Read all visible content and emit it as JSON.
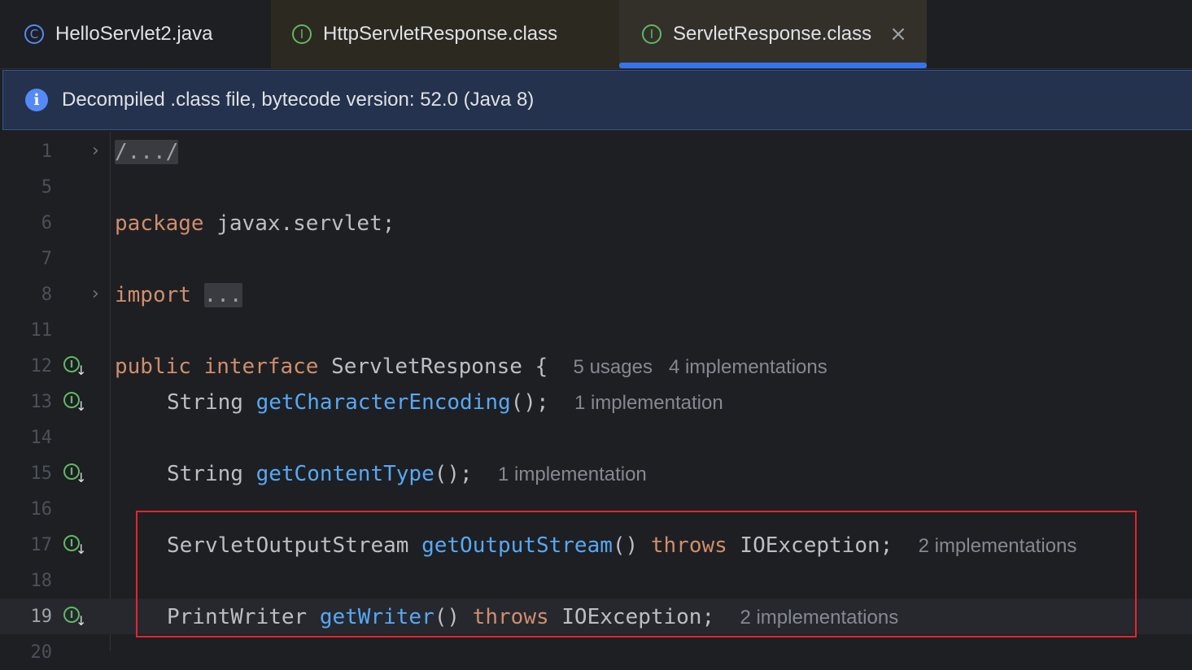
{
  "tabs": [
    {
      "label": "HelloServlet2.java",
      "icon": "class-icon",
      "icon_glyph": "C"
    },
    {
      "label": "HttpServletResponse.class",
      "icon": "interface-icon",
      "icon_glyph": "I"
    },
    {
      "label": "ServletResponse.class",
      "icon": "interface-icon",
      "icon_glyph": "I",
      "active": true,
      "close_glyph": "×"
    }
  ],
  "banner": {
    "message": "Decompiled .class file, bytecode version: 52.0 (Java 8)",
    "icon_glyph": "i"
  },
  "editor": {
    "lines": [
      {
        "n": "1",
        "folded": "/.../"
      },
      {
        "n": "5"
      },
      {
        "n": "6",
        "kw": "package",
        "rest": " javax.servlet;"
      },
      {
        "n": "7"
      },
      {
        "n": "8",
        "kw": "import",
        "folded": "..."
      },
      {
        "n": "11"
      },
      {
        "n": "12",
        "kw1": "public",
        "kw2": "interface",
        "rest": " ServletResponse {",
        "hint": "5 usages   4 implementations"
      },
      {
        "n": "13",
        "type": "String ",
        "fn": "getCharacterEncoding",
        "rest": "();",
        "hint": "1 implementation"
      },
      {
        "n": "14"
      },
      {
        "n": "15",
        "type": "String ",
        "fn": "getContentType",
        "rest": "();",
        "hint": "1 implementation"
      },
      {
        "n": "16"
      },
      {
        "n": "17",
        "type": "ServletOutputStream ",
        "fn": "getOutputStream",
        "mid": "() ",
        "kw": "throws",
        "rest": " IOException;",
        "hint": "2 implementations"
      },
      {
        "n": "18"
      },
      {
        "n": "19",
        "type": "PrintWriter ",
        "fn": "getWriter",
        "mid": "() ",
        "kw": "throws",
        "rest": " IOException;",
        "hint": "2 implementations"
      },
      {
        "n": "20"
      }
    ],
    "gutter_icon_glyph": "I",
    "gutter_arrow_glyph": "↓",
    "fold_glyph": "›"
  },
  "colors": {
    "keyword": "#cf8e6d",
    "method": "#56a8f5",
    "accent": "#3574f0",
    "highlight_box": "#e0262c"
  }
}
